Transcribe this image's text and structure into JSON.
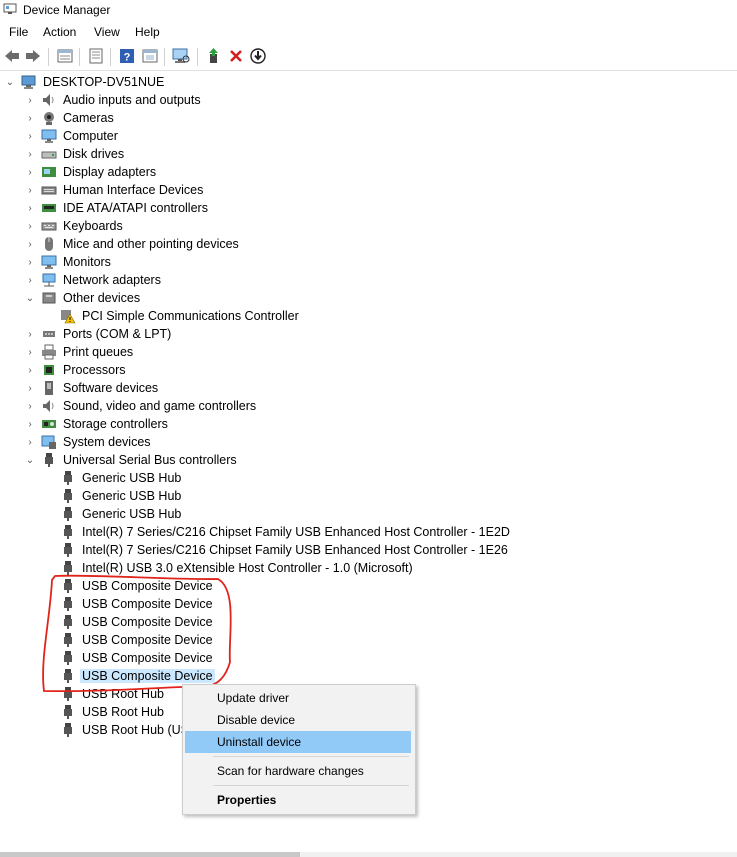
{
  "window": {
    "title": "Device Manager"
  },
  "menu": [
    "File",
    "Action",
    "View",
    "Help"
  ],
  "toolbar": {
    "icons": [
      "back-icon",
      "forward-icon",
      "properties-icon",
      "show-hidden-icon",
      "help-icon",
      "view-icon",
      "scan-hardware-icon",
      "update-driver-icon",
      "uninstall-icon",
      "disable-icon"
    ]
  },
  "tree": {
    "root": "DESKTOP-DV51NUE",
    "categories": [
      "Audio inputs and outputs",
      "Cameras",
      "Computer",
      "Disk drives",
      "Display adapters",
      "Human Interface Devices",
      "IDE ATA/ATAPI controllers",
      "Keyboards",
      "Mice and other pointing devices",
      "Monitors",
      "Network adapters",
      "Other devices",
      "Ports (COM & LPT)",
      "Print queues",
      "Processors",
      "Software devices",
      "Sound, video and game controllers",
      "Storage controllers",
      "System devices",
      "Universal Serial Bus controllers"
    ],
    "other_devices_children": [
      "PCI Simple Communications Controller"
    ],
    "usb_children": [
      "Generic USB Hub",
      "Generic USB Hub",
      "Generic USB Hub",
      "Intel(R) 7 Series/C216 Chipset Family USB Enhanced Host Controller - 1E2D",
      "Intel(R) 7 Series/C216 Chipset Family USB Enhanced Host Controller - 1E26",
      "Intel(R) USB 3.0 eXtensible Host Controller - 1.0 (Microsoft)",
      "USB Composite Device",
      "USB Composite Device",
      "USB Composite Device",
      "USB Composite Device",
      "USB Composite Device",
      "USB Composite Device",
      "USB Root Hub",
      "USB Root Hub",
      "USB Root Hub (USB"
    ],
    "selected": "USB Composite Device"
  },
  "context_menu": {
    "items": [
      "Update driver",
      "Disable device",
      "Uninstall device",
      "Scan for hardware changes",
      "Properties"
    ],
    "highlighted": "Uninstall device"
  },
  "colors": {
    "selection": "#cce8ff",
    "menu_highlight": "#91c9f7",
    "annotation": "#e0241b"
  }
}
